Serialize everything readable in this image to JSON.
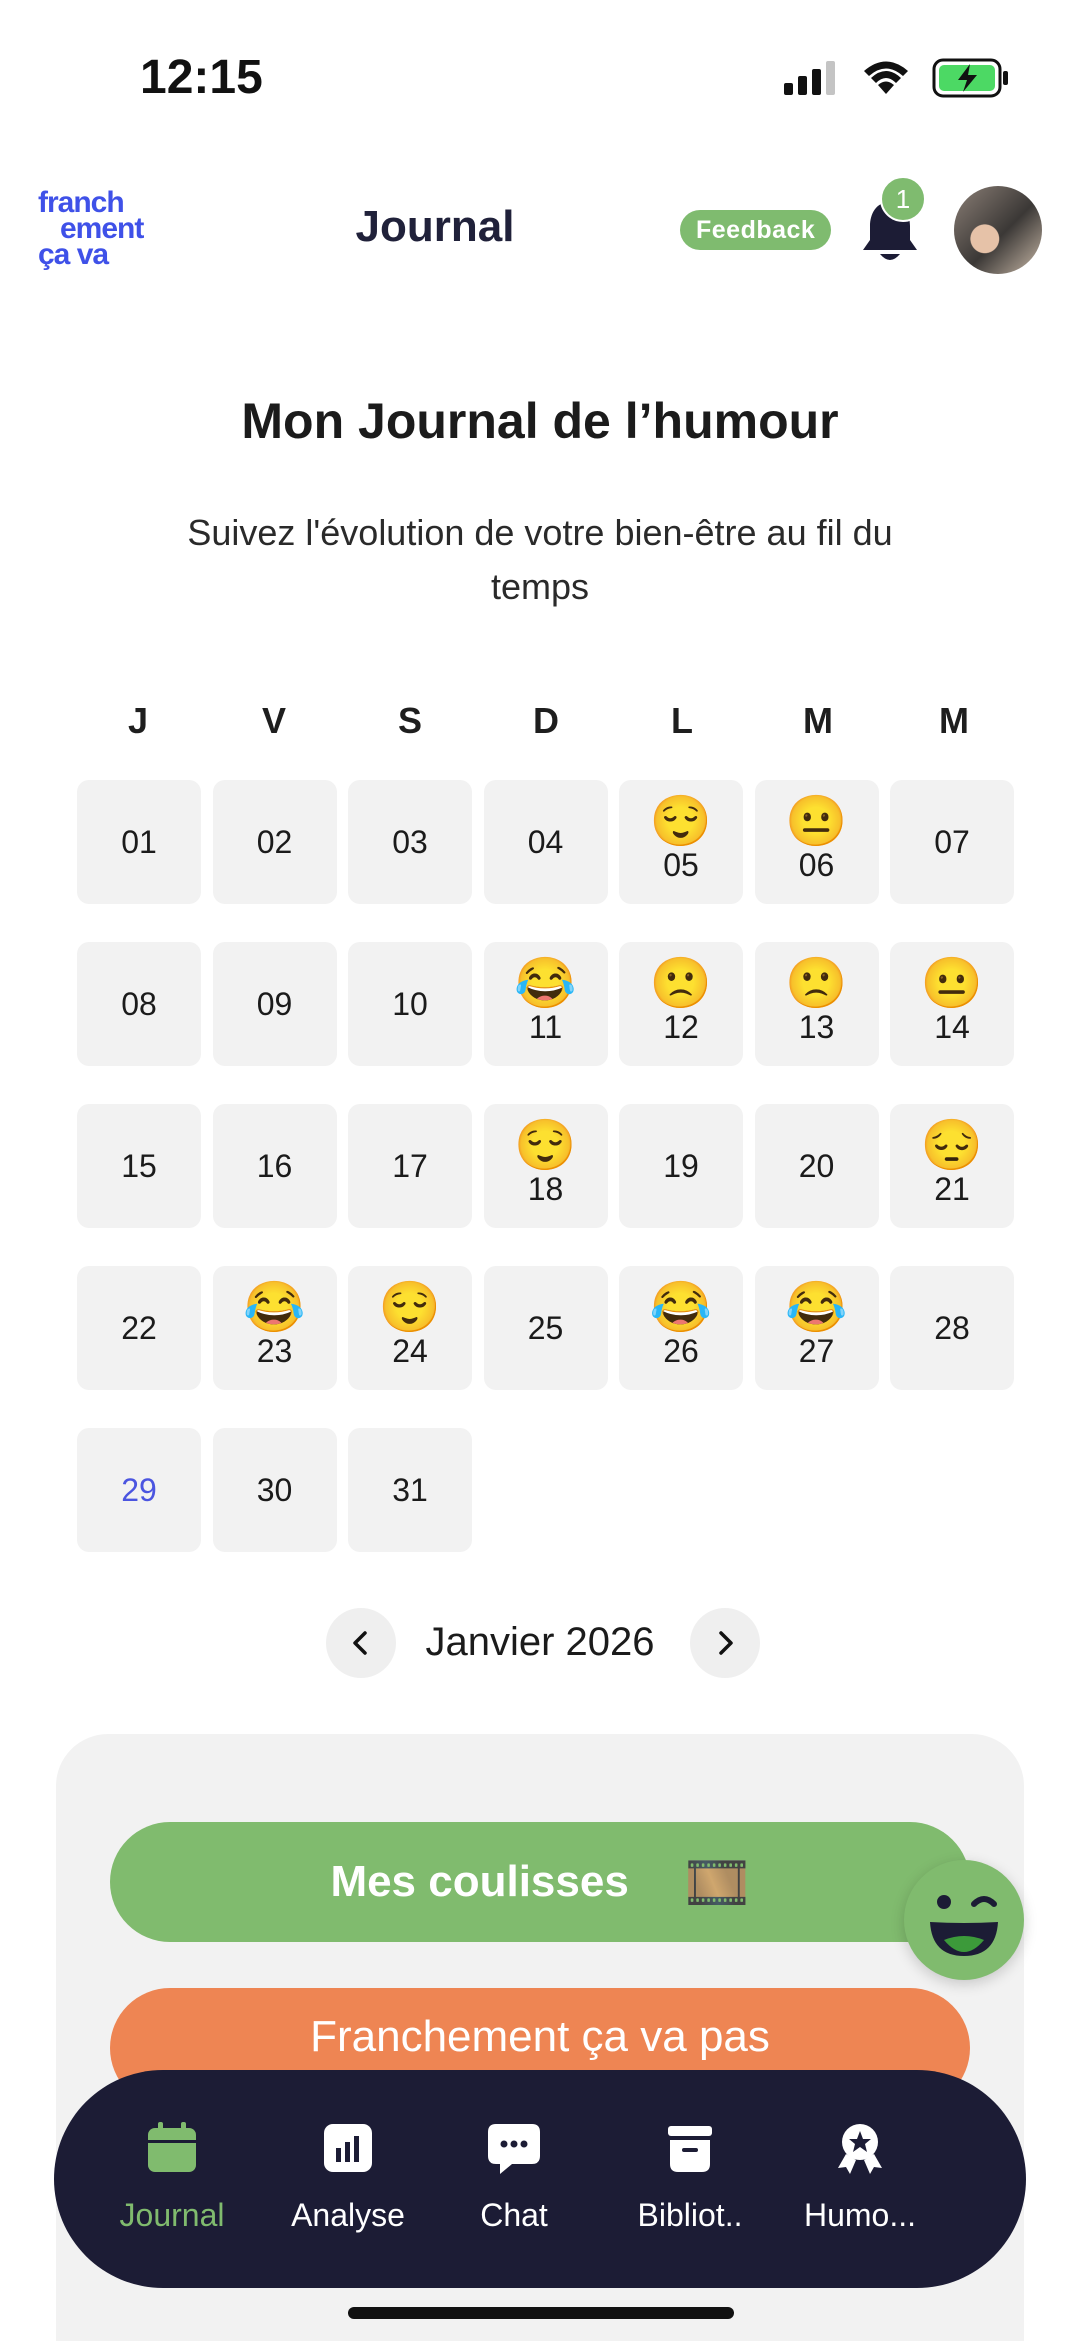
{
  "status_bar": {
    "time": "12:15"
  },
  "header": {
    "logo_lines": [
      "franch",
      "ement",
      "ça va"
    ],
    "title": "Journal",
    "feedback_label": "Feedback",
    "notification_count": "1"
  },
  "page": {
    "title": "Mon Journal de l’humour",
    "subtitle": "Suivez l'évolution de votre bien-être au fil du temps"
  },
  "calendar": {
    "weekdays": [
      "J",
      "V",
      "S",
      "D",
      "L",
      "M",
      "M"
    ],
    "today": "29",
    "days": [
      {
        "num": "01",
        "emoji": ""
      },
      {
        "num": "02",
        "emoji": ""
      },
      {
        "num": "03",
        "emoji": ""
      },
      {
        "num": "04",
        "emoji": ""
      },
      {
        "num": "05",
        "emoji": "😌"
      },
      {
        "num": "06",
        "emoji": "😐"
      },
      {
        "num": "07",
        "emoji": ""
      },
      {
        "num": "08",
        "emoji": ""
      },
      {
        "num": "09",
        "emoji": ""
      },
      {
        "num": "10",
        "emoji": ""
      },
      {
        "num": "11",
        "emoji": "😂"
      },
      {
        "num": "12",
        "emoji": "🙁"
      },
      {
        "num": "13",
        "emoji": "🙁"
      },
      {
        "num": "14",
        "emoji": "😐"
      },
      {
        "num": "15",
        "emoji": ""
      },
      {
        "num": "16",
        "emoji": ""
      },
      {
        "num": "17",
        "emoji": ""
      },
      {
        "num": "18",
        "emoji": "😌"
      },
      {
        "num": "19",
        "emoji": ""
      },
      {
        "num": "20",
        "emoji": ""
      },
      {
        "num": "21",
        "emoji": "😔"
      },
      {
        "num": "22",
        "emoji": ""
      },
      {
        "num": "23",
        "emoji": "😂"
      },
      {
        "num": "24",
        "emoji": "😌"
      },
      {
        "num": "25",
        "emoji": ""
      },
      {
        "num": "26",
        "emoji": "😂"
      },
      {
        "num": "27",
        "emoji": "😂"
      },
      {
        "num": "28",
        "emoji": ""
      },
      {
        "num": "29",
        "emoji": ""
      },
      {
        "num": "30",
        "emoji": ""
      },
      {
        "num": "31",
        "emoji": ""
      }
    ],
    "month_label": "Janvier 2026"
  },
  "actions": {
    "coulisses_label": "Mes coulisses",
    "coulisses_icon": "🎞️",
    "pas_label": "Franchement ça va pas"
  },
  "tabs": [
    {
      "label": "Journal",
      "icon": "calendar-icon",
      "active": true
    },
    {
      "label": "Analyse",
      "icon": "chart-icon",
      "active": false
    },
    {
      "label": "Chat",
      "icon": "chat-icon",
      "active": false
    },
    {
      "label": "Bibliot..",
      "icon": "archive-icon",
      "active": false
    },
    {
      "label": "Humo...",
      "icon": "award-icon",
      "active": false
    }
  ],
  "colors": {
    "green": "#80bb6e",
    "orange": "#ee8553",
    "navy": "#1c1c35",
    "brand_blue": "#3f51e8",
    "today_blue": "#4b55e0"
  }
}
